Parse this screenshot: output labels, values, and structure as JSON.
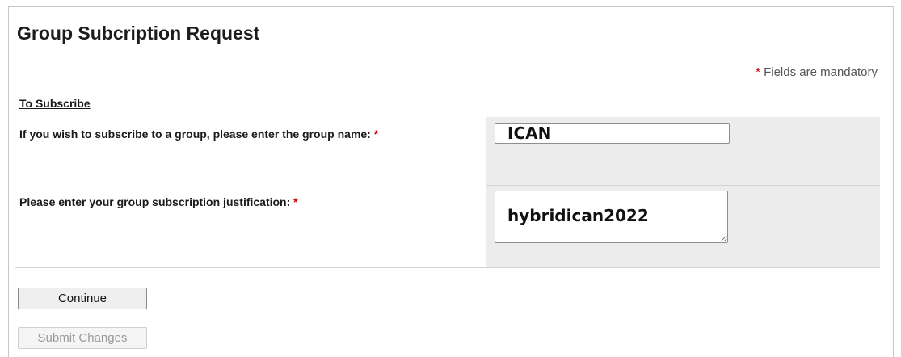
{
  "form": {
    "title": "Group Subcription Request",
    "mandatory_star": "*",
    "mandatory_note": " Fields are mandatory",
    "section_label": "To Subscribe",
    "group_field": {
      "label": "If you wish to subscribe to a group, please enter the group name: ",
      "required_star": "*",
      "value": "ICAN"
    },
    "justification_field": {
      "label": "Please enter your group subscription justification: ",
      "required_star": "*",
      "value": "hybridican2022"
    },
    "continue_label": "Continue",
    "submit_label": "Submit Changes"
  },
  "colors": {
    "required_star": "#d10000",
    "field_background": "#ececec"
  }
}
